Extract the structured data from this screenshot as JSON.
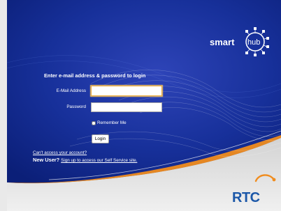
{
  "brand": {
    "logo_text_a": "smart",
    "logo_text_b": "hub",
    "company": "RTC"
  },
  "login": {
    "title": "Enter e-mail address & password to login",
    "email_label": "E-Mail Address",
    "password_label": "Password",
    "email_value": "",
    "password_value": "",
    "remember_label": "Remember Me",
    "remember_checked": false,
    "submit_label": "Login"
  },
  "links": {
    "cant_access": "Can't access your account?",
    "new_user_label": "New User?",
    "signup": "Sign up to access our Self Service site."
  },
  "colors": {
    "background_navy": "#0f2a8c",
    "accent_orange": "#f08c1e",
    "brand_blue": "#1b57a8"
  }
}
